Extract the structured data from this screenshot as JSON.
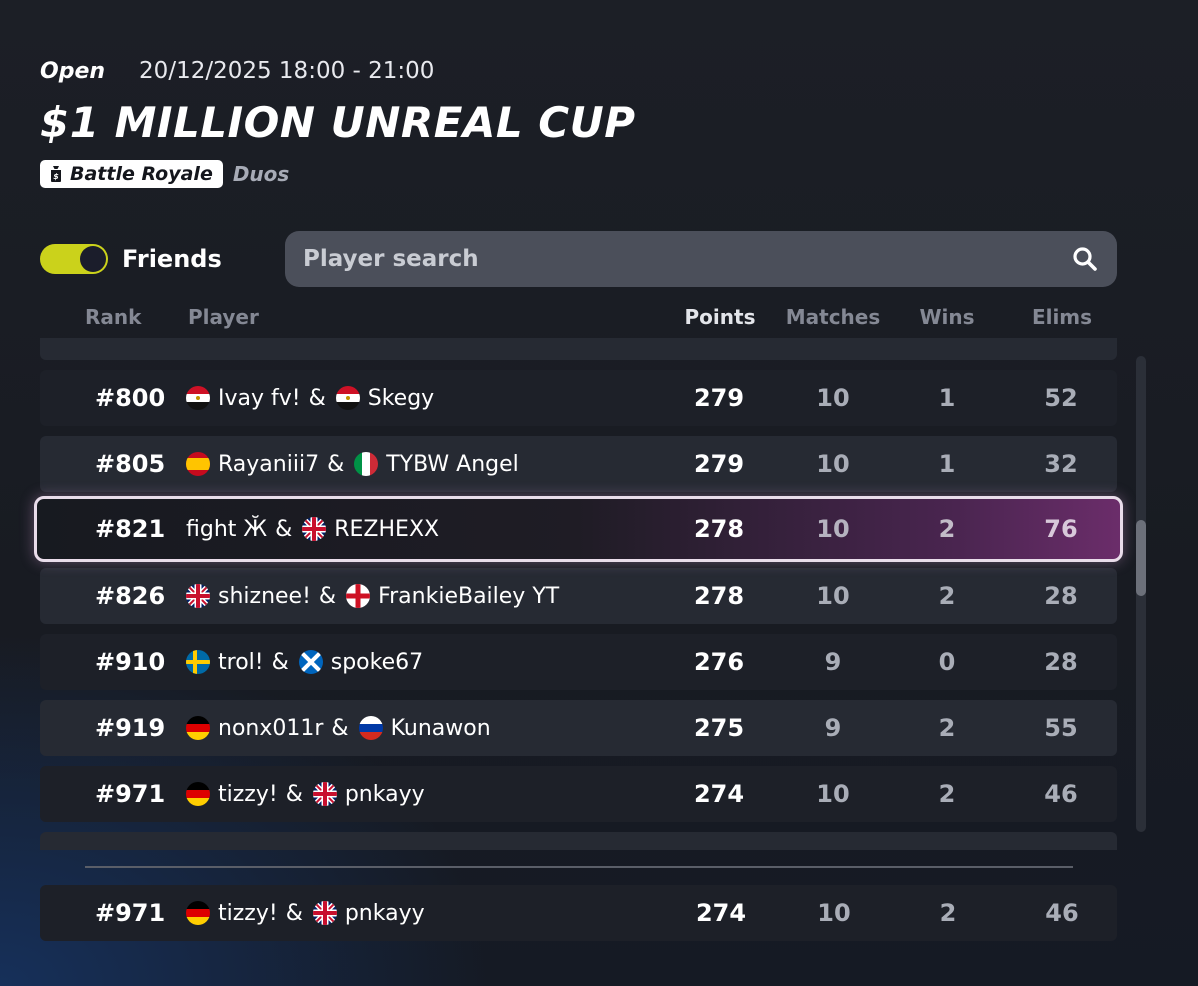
{
  "event": {
    "status": "Open",
    "datetime": "20/12/2025 18:00 - 21:00",
    "title": "$1 MILLION UNREAL CUP",
    "mode": "Battle Royale",
    "team_mode": "Duos"
  },
  "filters": {
    "friends_label": "Friends",
    "friends_on": true,
    "search_placeholder": "Player search"
  },
  "columns": {
    "rank": "Rank",
    "player": "Player",
    "points": "Points",
    "matches": "Matches",
    "wins": "Wins",
    "elims": "Elims"
  },
  "rows": [
    {
      "rank": "#800",
      "p1": "Ivay fv!",
      "f1": "egypt",
      "p2": "Skegy",
      "f2": "egypt",
      "points": "279",
      "matches": "10",
      "wins": "1",
      "elims": "52"
    },
    {
      "rank": "#805",
      "p1": "Rayaniii7",
      "f1": "spain",
      "p2": "TYBW Angel",
      "f2": "italy",
      "points": "279",
      "matches": "10",
      "wins": "1",
      "elims": "32"
    },
    {
      "rank": "#821",
      "p1": "fight Ӂ",
      "f1": "",
      "p2": "REZHEXX",
      "f2": "uk",
      "points": "278",
      "matches": "10",
      "wins": "2",
      "elims": "76"
    },
    {
      "rank": "#826",
      "p1": "shiznee!",
      "f1": "uk",
      "p2": "FrankieBailey YT",
      "f2": "england",
      "points": "278",
      "matches": "10",
      "wins": "2",
      "elims": "28"
    },
    {
      "rank": "#910",
      "p1": "trol!",
      "f1": "sweden",
      "p2": "spoke67",
      "f2": "scotland",
      "points": "276",
      "matches": "9",
      "wins": "0",
      "elims": "28"
    },
    {
      "rank": "#919",
      "p1": "nonx011r",
      "f1": "germany",
      "p2": "Kunawon",
      "f2": "russia",
      "points": "275",
      "matches": "9",
      "wins": "2",
      "elims": "55"
    },
    {
      "rank": "#971",
      "p1": "tizzy!",
      "f1": "germany",
      "p2": "pnkayy",
      "f2": "uk",
      "points": "274",
      "matches": "10",
      "wins": "2",
      "elims": "46"
    }
  ],
  "my_row": {
    "rank": "#971",
    "p1": "tizzy!",
    "f1": "germany",
    "p2": "pnkayy",
    "f2": "uk",
    "points": "274",
    "matches": "10",
    "wins": "2",
    "elims": "46"
  },
  "amp": "&",
  "colors": {
    "toggle": "#cbd21b",
    "highlight": "#7a3478",
    "accent": "#e9dcea"
  },
  "icons": {
    "search": "search-icon",
    "mode": "money-bag-icon"
  }
}
